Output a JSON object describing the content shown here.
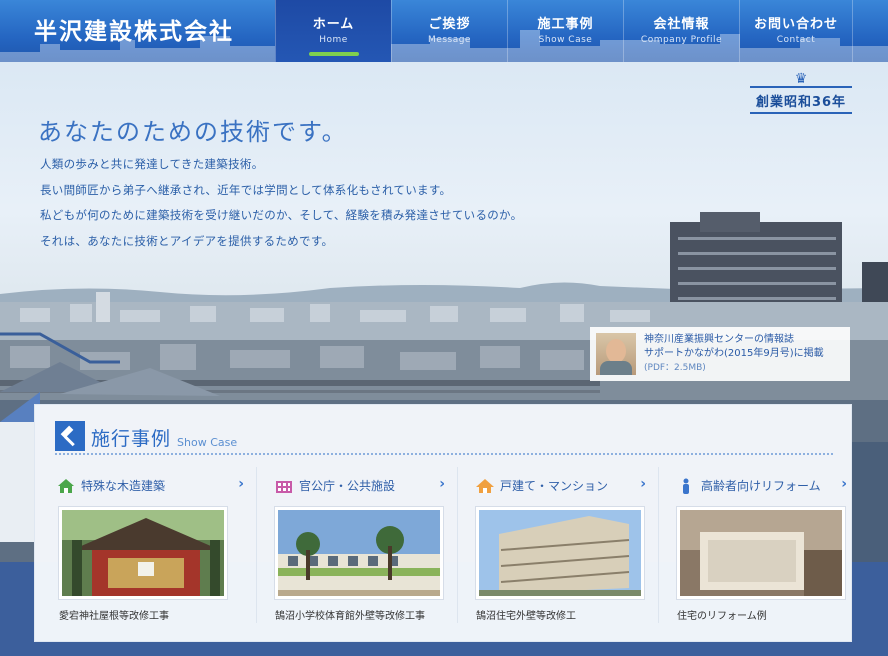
{
  "header": {
    "logo": "半沢建設株式会社",
    "nav": [
      {
        "jp": "ホーム",
        "en": "Home",
        "active": true
      },
      {
        "jp": "ご挨拶",
        "en": "Message",
        "active": false
      },
      {
        "jp": "施工事例",
        "en": "Show Case",
        "active": false
      },
      {
        "jp": "会社情報",
        "en": "Company Profile",
        "active": false
      },
      {
        "jp": "お問い合わせ",
        "en": "Contact",
        "active": false
      }
    ]
  },
  "hero": {
    "badge": "創業昭和36年",
    "headline": "あなたのための技術です。",
    "lead": [
      "人類の歩みと共に発達してきた建築技術。",
      "長い間師匠から弟子へ継承され、近年では学問として体系化もされています。",
      "私どもが何のために建築技術を受け継いだのか、そして、経験を積み発達させているのか。",
      "それは、あなたに技術とアイデアを提供するためです。"
    ],
    "news": {
      "line1": "神奈川産業振興センターの情報誌",
      "line2": "サポートかながわ(2015年9月号)に掲載",
      "line3": "(PDF：2.5MB)"
    }
  },
  "showcase": {
    "title": "施行事例",
    "subtitle": "Show Case",
    "cards": [
      {
        "category": "特殊な木造建築",
        "caption": "愛宕神社屋根等改修工事",
        "icon": "house-icon",
        "icon_color": "#4aa64a"
      },
      {
        "category": "官公庁・公共施設",
        "caption": "鵠沼小学校体育館外壁等改修工事",
        "icon": "building-icon",
        "icon_color": "#c85aa8"
      },
      {
        "category": "戸建て・マンション",
        "caption": "鵠沼住宅外壁等改修工",
        "icon": "home-icon",
        "icon_color": "#f0a040"
      },
      {
        "category": "高齢者向けリフォーム",
        "caption": "住宅のリフォーム例",
        "icon": "person-icon",
        "icon_color": "#3a75cc"
      }
    ]
  }
}
